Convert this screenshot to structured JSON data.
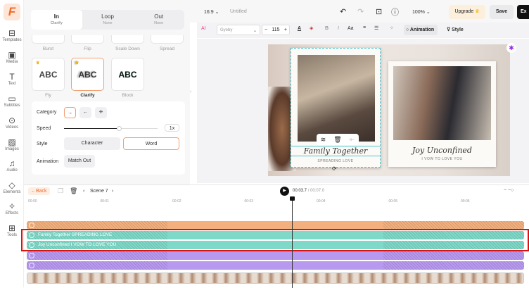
{
  "sidebar": {
    "logo": "F",
    "items": [
      {
        "label": "Templates",
        "icon": "⊟"
      },
      {
        "label": "Media",
        "icon": "▣"
      },
      {
        "label": "Text",
        "icon": "T"
      },
      {
        "label": "Subtitles",
        "icon": "▭"
      },
      {
        "label": "Videos",
        "icon": "⊙"
      },
      {
        "label": "Images",
        "icon": "▨"
      },
      {
        "label": "Audio",
        "icon": "♫"
      },
      {
        "label": "Elements",
        "icon": "◇"
      },
      {
        "label": "Effects",
        "icon": "✧"
      },
      {
        "label": "Tools",
        "icon": "⊞"
      }
    ]
  },
  "panel": {
    "tabs": [
      {
        "label": "In",
        "sub": "Clarify"
      },
      {
        "label": "Loop",
        "sub": "None"
      },
      {
        "label": "Out",
        "sub": "None"
      }
    ],
    "row1": [
      "Burst",
      "Flip",
      "Scale Down",
      "Spread"
    ],
    "cards": [
      {
        "label": "Fly",
        "preview": "ABC"
      },
      {
        "label": "Clarify",
        "preview": "ABC"
      },
      {
        "label": "Block",
        "preview": "ABC"
      }
    ],
    "category_label": "Category",
    "category_options": [
      "→",
      "←",
      "⁜"
    ],
    "speed_label": "Speed",
    "speed_value": "1x",
    "speed_fraction": 0.59,
    "style_label": "Style",
    "style_options": [
      "Character",
      "Word"
    ],
    "style_selected": "Word",
    "animation_label": "Animation",
    "animation_button": "Match Out"
  },
  "topbar": {
    "ratio": "16:9 ⌄",
    "title": "Untitled",
    "zoom": "100% ⌄",
    "upgrade": "Upgrade",
    "save": "Save",
    "export": "Ex"
  },
  "format": {
    "font": "Gyeby",
    "size": "115",
    "animation": "Animation",
    "style": "Style"
  },
  "canvas": {
    "card1_title": "Family Together",
    "card1_sub": "SPREADING LOVE",
    "card2_title": "Joy Unconfined",
    "card2_sub": "I VOW TO LOVE YOU"
  },
  "timeline": {
    "back": "←Back",
    "scene": "Scene 7",
    "current": "00:03.7",
    "total": " / 00:07.0",
    "ruler": [
      "00:00",
      "00:01",
      "00:02",
      "00:03",
      "00:04",
      "00:05",
      "00:06"
    ],
    "tracks": [
      {
        "label": "",
        "color": "#f3b07e"
      },
      {
        "label": "Family Together SPREADING LOVE",
        "color": "#7fd9c8"
      },
      {
        "label": "Joy Unconfined I VOW TO LOVE YOU",
        "color": "#7fd9c8"
      },
      {
        "label": "",
        "color": "#b899f0"
      },
      {
        "label": "",
        "color": "#b899f0"
      }
    ],
    "highlight_color": "#dd1111"
  }
}
